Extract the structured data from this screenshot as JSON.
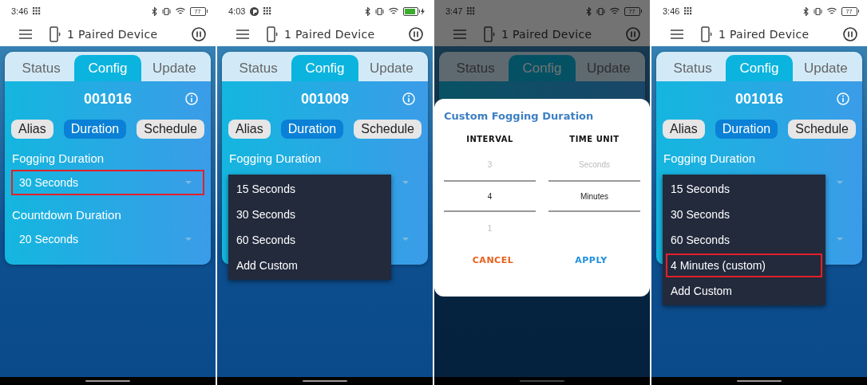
{
  "screens": [
    {
      "status_bar": {
        "time": "3:46",
        "notification_icons": [
          {
            "kind": "grid"
          }
        ],
        "battery_text": "77",
        "charging": false
      },
      "app_bar": {
        "title": "1 Paired Device"
      },
      "tabs": [
        {
          "label": "Status",
          "selected": false
        },
        {
          "label": "Config",
          "selected": true
        },
        {
          "label": "Update",
          "selected": false
        }
      ],
      "device_id": "001016",
      "chips": [
        {
          "label": "Alias",
          "selected": false
        },
        {
          "label": "Duration",
          "selected": true
        },
        {
          "label": "Schedule",
          "selected": false
        }
      ],
      "fields": [
        {
          "label": "Fogging Duration",
          "value": "30 Seconds",
          "highlighted": true
        },
        {
          "label": "Countdown Duration",
          "value": "20 Seconds",
          "highlighted": false
        }
      ],
      "dimmed": false
    },
    {
      "status_bar": {
        "time": "4:03",
        "notification_icons": [
          {
            "kind": "circle"
          },
          {
            "kind": "grid"
          }
        ],
        "charging": true
      },
      "app_bar": {
        "title": "1 Paired Device"
      },
      "tabs": [
        {
          "label": "Status",
          "selected": false
        },
        {
          "label": "Config",
          "selected": true
        },
        {
          "label": "Update",
          "selected": false
        }
      ],
      "device_id": "001009",
      "chips": [
        {
          "label": "Alias",
          "selected": false
        },
        {
          "label": "Duration",
          "selected": true
        },
        {
          "label": "Schedule",
          "selected": false
        }
      ],
      "fields": [
        {
          "label": "Fogging Duration",
          "highlighted": false
        },
        {
          "highlighted": false
        }
      ],
      "menu": {
        "options": [
          {
            "label": "15 Seconds",
            "highlighted": false
          },
          {
            "label": "30 Seconds",
            "highlighted": false
          },
          {
            "label": "60 Seconds",
            "highlighted": false
          },
          {
            "label": "Add Custom",
            "highlighted": false
          }
        ]
      },
      "dimmed": false
    },
    {
      "status_bar": {
        "time": "3:47",
        "notification_icons": [
          {
            "kind": "grid"
          }
        ],
        "battery_text": "77",
        "charging": false
      },
      "app_bar": {
        "title": "1 Paired Device"
      },
      "tabs": [
        {
          "label": "Status",
          "selected": false
        },
        {
          "label": "Config",
          "selected": true
        },
        {
          "label": "Update",
          "selected": false
        }
      ],
      "dimmed": true,
      "dialog": {
        "title": "Custom Fogging Duration",
        "columns": [
          {
            "header": "INTERVAL",
            "options": [
              {
                "label": "3",
                "selected": false
              },
              {
                "label": "4",
                "selected": true
              },
              {
                "label": "1",
                "selected": false
              }
            ]
          },
          {
            "header": "TIME UNIT",
            "options": [
              {
                "label": "Seconds",
                "selected": false
              },
              {
                "label": "Minutes",
                "selected": true
              }
            ]
          }
        ],
        "cancel": "CANCEL",
        "apply": "APPLY"
      }
    },
    {
      "status_bar": {
        "time": "3:46",
        "notification_icons": [
          {
            "kind": "grid"
          }
        ],
        "battery_text": "77",
        "charging": false
      },
      "app_bar": {
        "title": "1 Paired Device"
      },
      "tabs": [
        {
          "label": "Status",
          "selected": false
        },
        {
          "label": "Config",
          "selected": true
        },
        {
          "label": "Update",
          "selected": false
        }
      ],
      "device_id": "001016",
      "chips": [
        {
          "label": "Alias",
          "selected": false
        },
        {
          "label": "Duration",
          "selected": true
        },
        {
          "label": "Schedule",
          "selected": false
        }
      ],
      "fields": [
        {
          "label": "Fogging Duration",
          "highlighted": false
        },
        {
          "highlighted": false
        }
      ],
      "menu": {
        "options": [
          {
            "label": "15 Seconds",
            "highlighted": false
          },
          {
            "label": "30 Seconds",
            "highlighted": false
          },
          {
            "label": "60 Seconds",
            "highlighted": false
          },
          {
            "label": "4 Minutes (custom)",
            "highlighted": true
          },
          {
            "label": "Add Custom",
            "highlighted": false
          }
        ]
      },
      "dimmed": false
    }
  ]
}
